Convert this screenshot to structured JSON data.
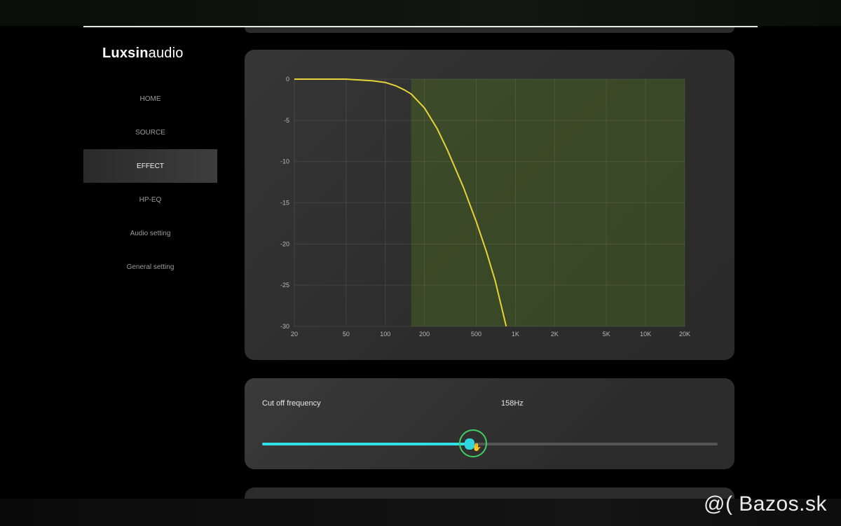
{
  "brand": {
    "bold": "Luxsin",
    "light": "audio"
  },
  "nav": {
    "items": [
      {
        "label": "HOME",
        "active": false
      },
      {
        "label": "SOURCE",
        "active": false
      },
      {
        "label": "EFFECT",
        "active": true
      },
      {
        "label": "HP-EQ",
        "active": false
      },
      {
        "label": "Audio setting",
        "active": false
      },
      {
        "label": "General setting",
        "active": false
      }
    ]
  },
  "filter": {
    "label": "Cut off frequency",
    "value_text": "158Hz",
    "slider_fraction": 0.455
  },
  "chart_data": {
    "type": "line",
    "x_scale": "log",
    "xlim": [
      20,
      20000
    ],
    "ylim": [
      -30,
      0
    ],
    "x_ticks": [
      20,
      50,
      100,
      200,
      500,
      1000,
      2000,
      5000,
      10000,
      20000
    ],
    "x_tick_labels": [
      "20",
      "50",
      "100",
      "200",
      "500",
      "1K",
      "2K",
      "5K",
      "10K",
      "20K"
    ],
    "y_ticks": [
      0,
      -5,
      -10,
      -15,
      -20,
      -25,
      -30
    ],
    "y_tick_labels": [
      "0",
      "-5",
      "-10",
      "-15",
      "-20",
      "-25",
      "-30"
    ],
    "grid": true,
    "stopband_start_hz": 158,
    "series": [
      {
        "color": "#e6d23a",
        "x": [
          20,
          50,
          80,
          100,
          120,
          140,
          158,
          200,
          250,
          300,
          400,
          500,
          600,
          700,
          850
        ],
        "y": [
          0,
          0,
          -0.2,
          -0.4,
          -0.8,
          -1.3,
          -1.8,
          -3.5,
          -6.0,
          -8.6,
          -13.2,
          -17.3,
          -21.0,
          -24.5,
          -30.0
        ]
      }
    ],
    "fill_color": "#4a6a20"
  },
  "watermark": {
    "text": "@( Bazos.sk"
  }
}
